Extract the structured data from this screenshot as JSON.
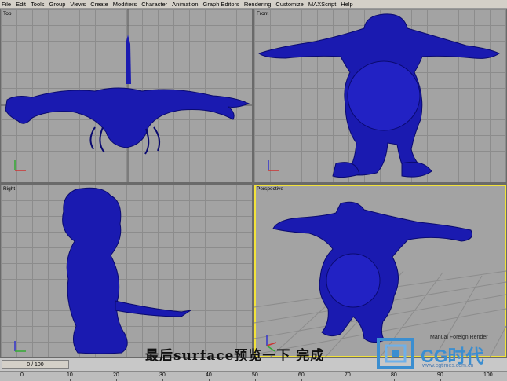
{
  "menu": [
    "File",
    "Edit",
    "Tools",
    "Group",
    "Views",
    "Create",
    "Modifiers",
    "Character",
    "Animation",
    "Graph Editors",
    "Rendering",
    "Customize",
    "MAXScript",
    "Help"
  ],
  "viewports": {
    "top": "Top",
    "front": "Front",
    "right": "Right",
    "perspective": "Perspective"
  },
  "perspective_status": "Manual Foreign Render",
  "time_slider": "0 / 100",
  "timeline_ticks": [
    "0",
    "10",
    "20",
    "30",
    "40",
    "50",
    "60",
    "70",
    "80",
    "90",
    "100"
  ],
  "caption": "最后surface预览一下 完成",
  "logo": {
    "text": "CG时代",
    "url": "www.cgtimes.com.cn"
  },
  "colors": {
    "model": "#1a1ab0",
    "model_dark": "#0a0a70",
    "active_border": "#f2e23a",
    "grid": "#8c8c8c",
    "viewport_bg": "#a3a3a3"
  }
}
